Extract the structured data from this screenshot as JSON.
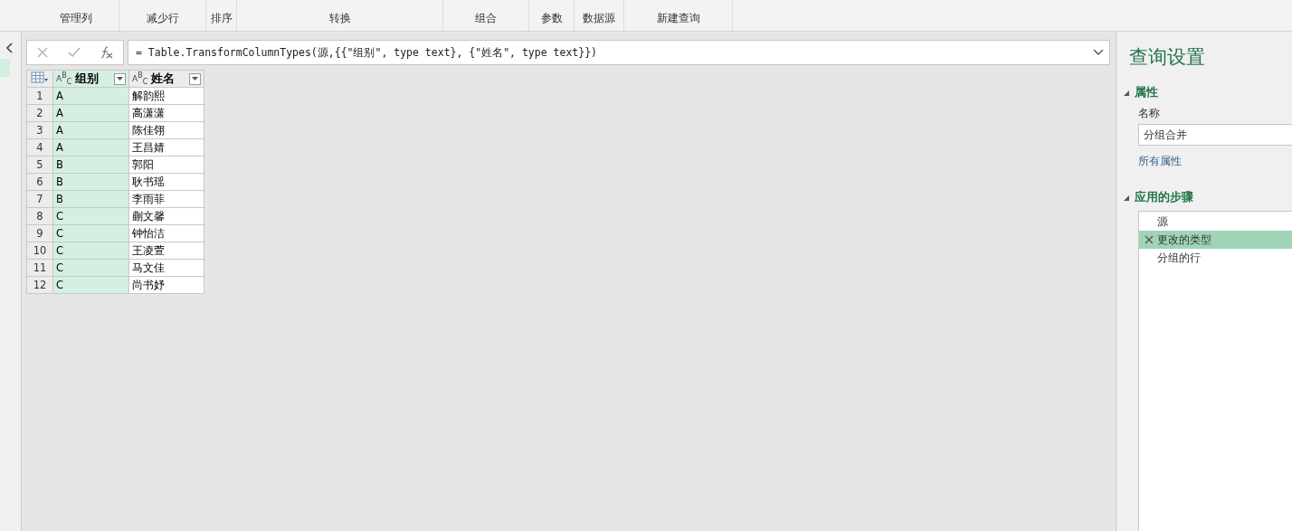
{
  "ribbon": {
    "groups": [
      {
        "label": "管理列"
      },
      {
        "label": "减少行"
      },
      {
        "label": "排序"
      },
      {
        "label": "转换"
      },
      {
        "label": "组合"
      },
      {
        "label": "参数"
      },
      {
        "label": "数据源"
      },
      {
        "label": "新建查询"
      }
    ]
  },
  "formula_bar": {
    "formula": "= Table.TransformColumnTypes(源,{{\"组别\", type text}, {\"姓名\", type text}})"
  },
  "table": {
    "columns": [
      {
        "type": "A$^{B}$$_{C}$",
        "label": "组别",
        "selected": true
      },
      {
        "type": "A$^{B}$$_{C}$",
        "label": "姓名",
        "selected": false
      }
    ],
    "rows": [
      {
        "index": "1",
        "cells": [
          "A",
          "解韵熙"
        ]
      },
      {
        "index": "2",
        "cells": [
          "A",
          "高潇潇"
        ]
      },
      {
        "index": "3",
        "cells": [
          "A",
          "陈佳翎"
        ]
      },
      {
        "index": "4",
        "cells": [
          "A",
          "王昌婧"
        ]
      },
      {
        "index": "5",
        "cells": [
          "B",
          "郭阳"
        ]
      },
      {
        "index": "6",
        "cells": [
          "B",
          "耿书瑶"
        ]
      },
      {
        "index": "7",
        "cells": [
          "B",
          "李雨菲"
        ]
      },
      {
        "index": "8",
        "cells": [
          "C",
          "蒯文馨"
        ]
      },
      {
        "index": "9",
        "cells": [
          "C",
          "钟怡洁"
        ]
      },
      {
        "index": "10",
        "cells": [
          "C",
          "王凌萱"
        ]
      },
      {
        "index": "11",
        "cells": [
          "C",
          "马文佳"
        ]
      },
      {
        "index": "12",
        "cells": [
          "C",
          "尚书妤"
        ]
      }
    ]
  },
  "query_settings": {
    "title": "查询设置",
    "properties_heading": "属性",
    "name_label": "名称",
    "name_value": "分组合并",
    "all_properties_link": "所有属性",
    "steps_heading": "应用的步骤",
    "steps": [
      {
        "label": "源",
        "selected": false
      },
      {
        "label": "更改的类型",
        "selected": true
      },
      {
        "label": "分组的行",
        "selected": false
      }
    ]
  }
}
